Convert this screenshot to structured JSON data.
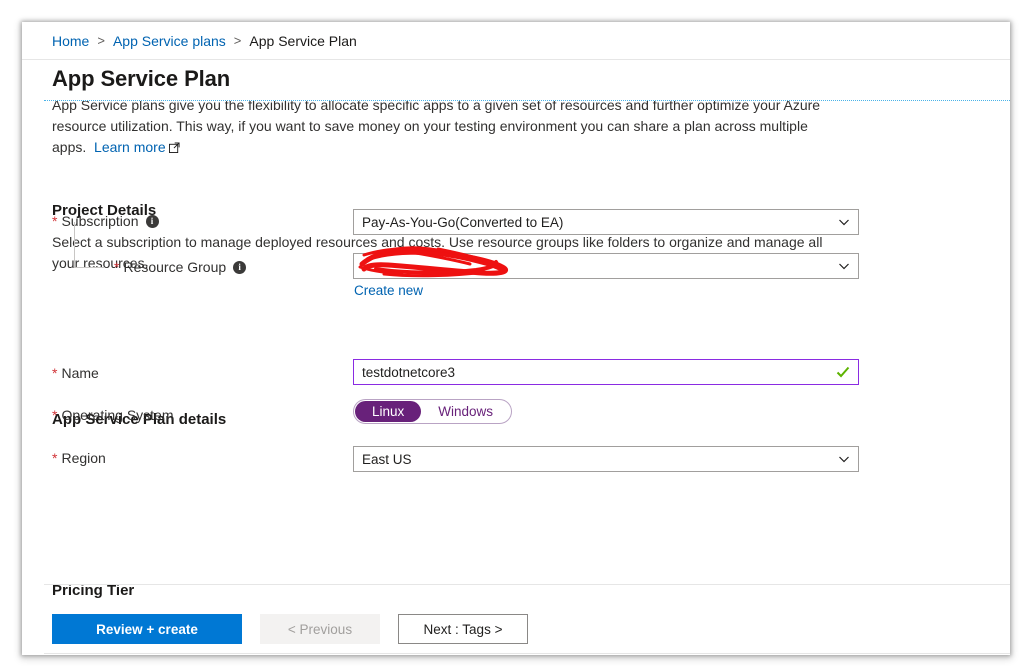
{
  "breadcrumb": {
    "items": [
      {
        "label": "Home",
        "link": true
      },
      {
        "label": "App Service plans",
        "link": true
      },
      {
        "label": "App Service Plan",
        "link": false
      }
    ],
    "separator": ">"
  },
  "header": {
    "title": "App Service Plan"
  },
  "intro": {
    "text": "App Service plans give you the flexibility to allocate specific apps to a given set of resources and further optimize your Azure resource utilization. This way, if you want to save money on your testing environment you can share a plan across multiple apps.",
    "learn_more_label": "Learn more",
    "learn_more_icon": "external-link-icon"
  },
  "project_details": {
    "heading": "Project Details",
    "description": "Select a subscription to manage deployed resources and costs. Use resource groups like folders to organize and manage all your resources.",
    "subscription": {
      "label": "Subscription",
      "required_marker": "*",
      "info_icon": "info-icon",
      "value": "Pay-As-You-Go(Converted to EA)",
      "chevron_icon": "chevron-down-icon"
    },
    "resource_group": {
      "label": "Resource Group",
      "required_marker": "*",
      "info_icon": "info-icon",
      "value": "",
      "redacted": true,
      "chevron_icon": "chevron-down-icon",
      "create_new_label": "Create new"
    }
  },
  "plan_details": {
    "heading": "App Service Plan details",
    "name": {
      "label": "Name",
      "required_marker": "*",
      "value": "testdotnetcore3",
      "validation_icon": "check-icon",
      "valid": true
    },
    "operating_system": {
      "label": "Operating System",
      "required_marker": "*",
      "options": [
        "Linux",
        "Windows"
      ],
      "selected": "Linux"
    },
    "region": {
      "label": "Region",
      "required_marker": "*",
      "value": "East US",
      "chevron_icon": "chevron-down-icon"
    }
  },
  "pricing_tier": {
    "heading": "Pricing Tier"
  },
  "footer": {
    "review_create_label": "Review + create",
    "previous_label": "< Previous",
    "next_label": "Next : Tags >"
  },
  "colors": {
    "accent_blue": "#0078d4",
    "link_blue": "#0063b1",
    "required_red": "#d13438",
    "azure_purple": "#68217a",
    "focus_purple": "#8a2be2",
    "valid_green": "#5db300",
    "redaction_red": "#ee1111"
  }
}
